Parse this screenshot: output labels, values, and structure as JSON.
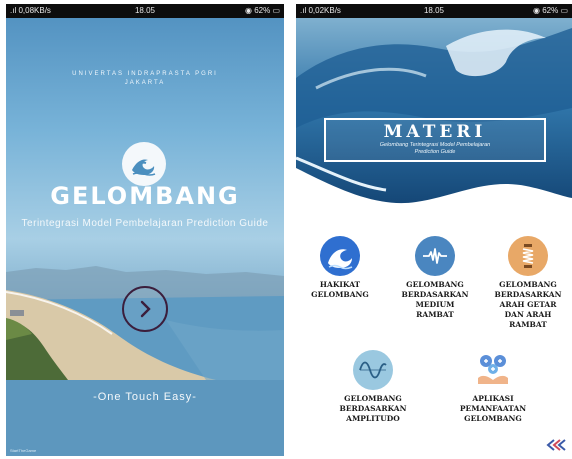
{
  "left_screen": {
    "status_bar": {
      "signal_speed": ".ıl 0,08KB/s",
      "time": "18.05",
      "battery": "62%"
    },
    "university": {
      "line1": "UNIVERTAS INDRAPRASTA PGRI",
      "line2": "JAKARTA"
    },
    "app_title": "GELOMBANG",
    "subtitle": "Terintegrasi Model Pembelajaran Prediction Guide",
    "tagline": "-One Touch Easy-",
    "watermark": "StartTheGame"
  },
  "right_screen": {
    "status_bar": {
      "signal_speed": ".ıl 0,02KB/s",
      "time": "18.05",
      "battery": "62%"
    },
    "header": {
      "title": "MATERI",
      "subtitle_line1": "Gelombang Terintegrasi Model Pembelajaran",
      "subtitle_line2": "Prediction Guide"
    },
    "menu": [
      {
        "lines": [
          "HAKIKAT",
          "GELOMBANG"
        ],
        "icon": "wave-icon",
        "color": "#2f6fd0"
      },
      {
        "lines": [
          "GELOMBANG",
          "BERDASARKAN",
          "MEDIUM",
          "RAMBAT"
        ],
        "icon": "pulse-wave-icon",
        "color": "#4a86c0"
      },
      {
        "lines": [
          "GELOMBANG",
          "BERDASARKAN",
          "ARAH GETAR",
          "DAN ARAH",
          "RAMBAT"
        ],
        "icon": "spring-icon",
        "color": "#e8a867"
      },
      {
        "lines": [
          "GELOMBANG",
          "BERDASARKAN",
          "AMPLITUDO"
        ],
        "icon": "sine-wave-icon",
        "color": "#9ac8e0"
      },
      {
        "lines": [
          "APLIKASI",
          "PEMANFAATAN",
          "GELOMBANG"
        ],
        "icon": "hands-plus-icon",
        "color": "#5b8fd8"
      }
    ]
  }
}
